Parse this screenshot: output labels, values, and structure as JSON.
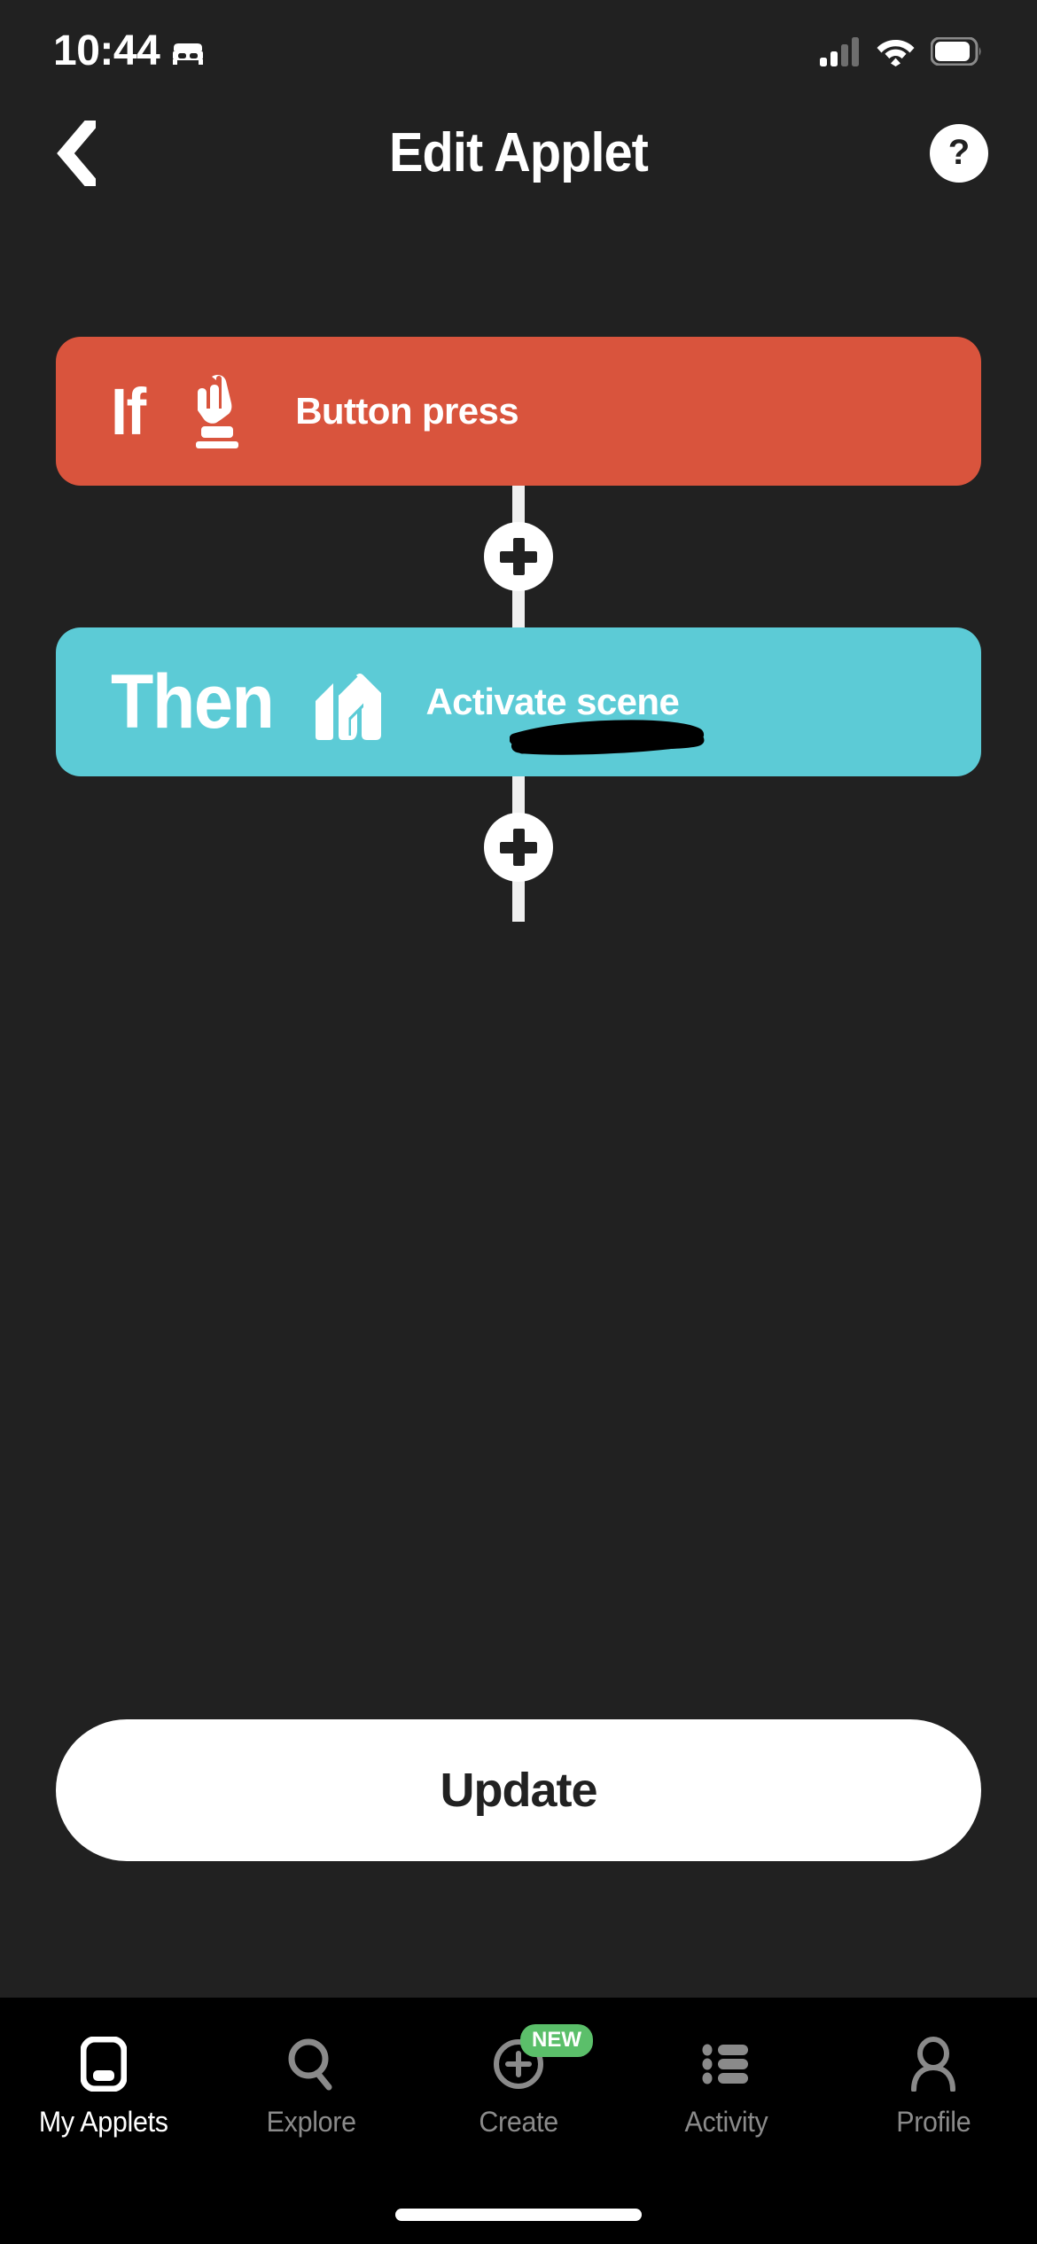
{
  "status_bar": {
    "time": "10:44",
    "sleep_icon": "bed-icon",
    "cellular_icon": "cellular-signal-icon",
    "wifi_icon": "wifi-icon",
    "battery_icon": "battery-icon"
  },
  "header": {
    "back_icon": "chevron-left-icon",
    "title": "Edit Applet",
    "help_label": "?"
  },
  "applet": {
    "if": {
      "keyword": "If",
      "service_icon": "button-press-icon",
      "service_text": "Button press",
      "color": "#D9543D"
    },
    "then": {
      "keyword": "Then",
      "service_icon": "home-assistant-icon",
      "service_text": "Activate scene",
      "redaction": "black-scribble-redaction",
      "color": "#5CCBD6"
    },
    "add_trigger_label": "+",
    "add_action_label": "+"
  },
  "primary_action": {
    "label": "Update"
  },
  "tabbar": {
    "items": [
      {
        "label": "My Applets",
        "icon": "my-applets-icon",
        "active": true,
        "badge": ""
      },
      {
        "label": "Explore",
        "icon": "search-icon",
        "active": false,
        "badge": ""
      },
      {
        "label": "Create",
        "icon": "plus-circle-icon",
        "active": false,
        "badge": "NEW"
      },
      {
        "label": "Activity",
        "icon": "list-icon",
        "active": false,
        "badge": ""
      },
      {
        "label": "Profile",
        "icon": "person-icon",
        "active": false,
        "badge": ""
      }
    ]
  },
  "colors": {
    "background": "#212121",
    "tabbar_background": "#000000",
    "if_card": "#D9543D",
    "then_card": "#5CCBD6",
    "badge_green": "#5BBF6A",
    "white": "#FFFFFF",
    "inactive_tab": "#8A8A8A"
  }
}
